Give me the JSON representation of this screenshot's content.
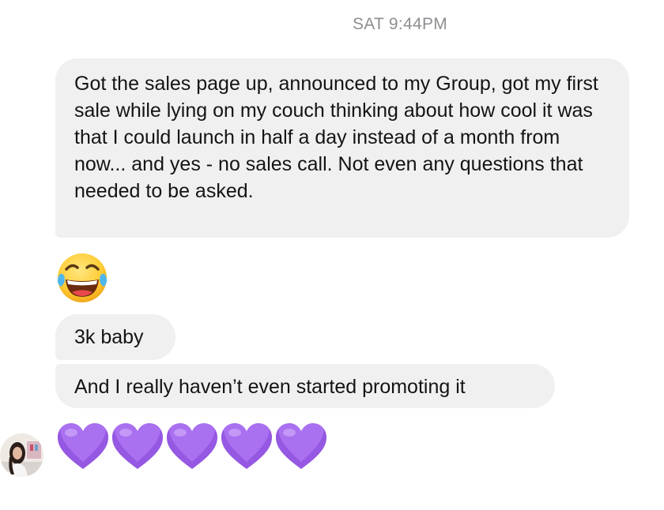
{
  "conversation": {
    "timestamp": "SAT 9:44PM",
    "messages": [
      {
        "type": "text",
        "text": "Got the sales page up, announced to my Group, got my first sale while lying on my couch thinking about how cool it was that I could launch in half a day instead of a month from now... and yes - no sales call. Not even any questions that needed to be asked."
      },
      {
        "type": "emoji",
        "icon": "face-with-tears-of-joy-icon"
      },
      {
        "type": "text",
        "text": "3k baby"
      },
      {
        "type": "text",
        "text": "And I really haven’t even started promoting it"
      },
      {
        "type": "emoji",
        "icon": "purple-heart-icon",
        "count": 5,
        "color": "#a970f0"
      }
    ],
    "sender_avatar": "profile-photo-avatar"
  },
  "colors": {
    "bubble_background": "#f0f0f0",
    "timestamp_text": "#8e8e93",
    "message_text": "#141414",
    "heart_purple": "#a970f0"
  }
}
